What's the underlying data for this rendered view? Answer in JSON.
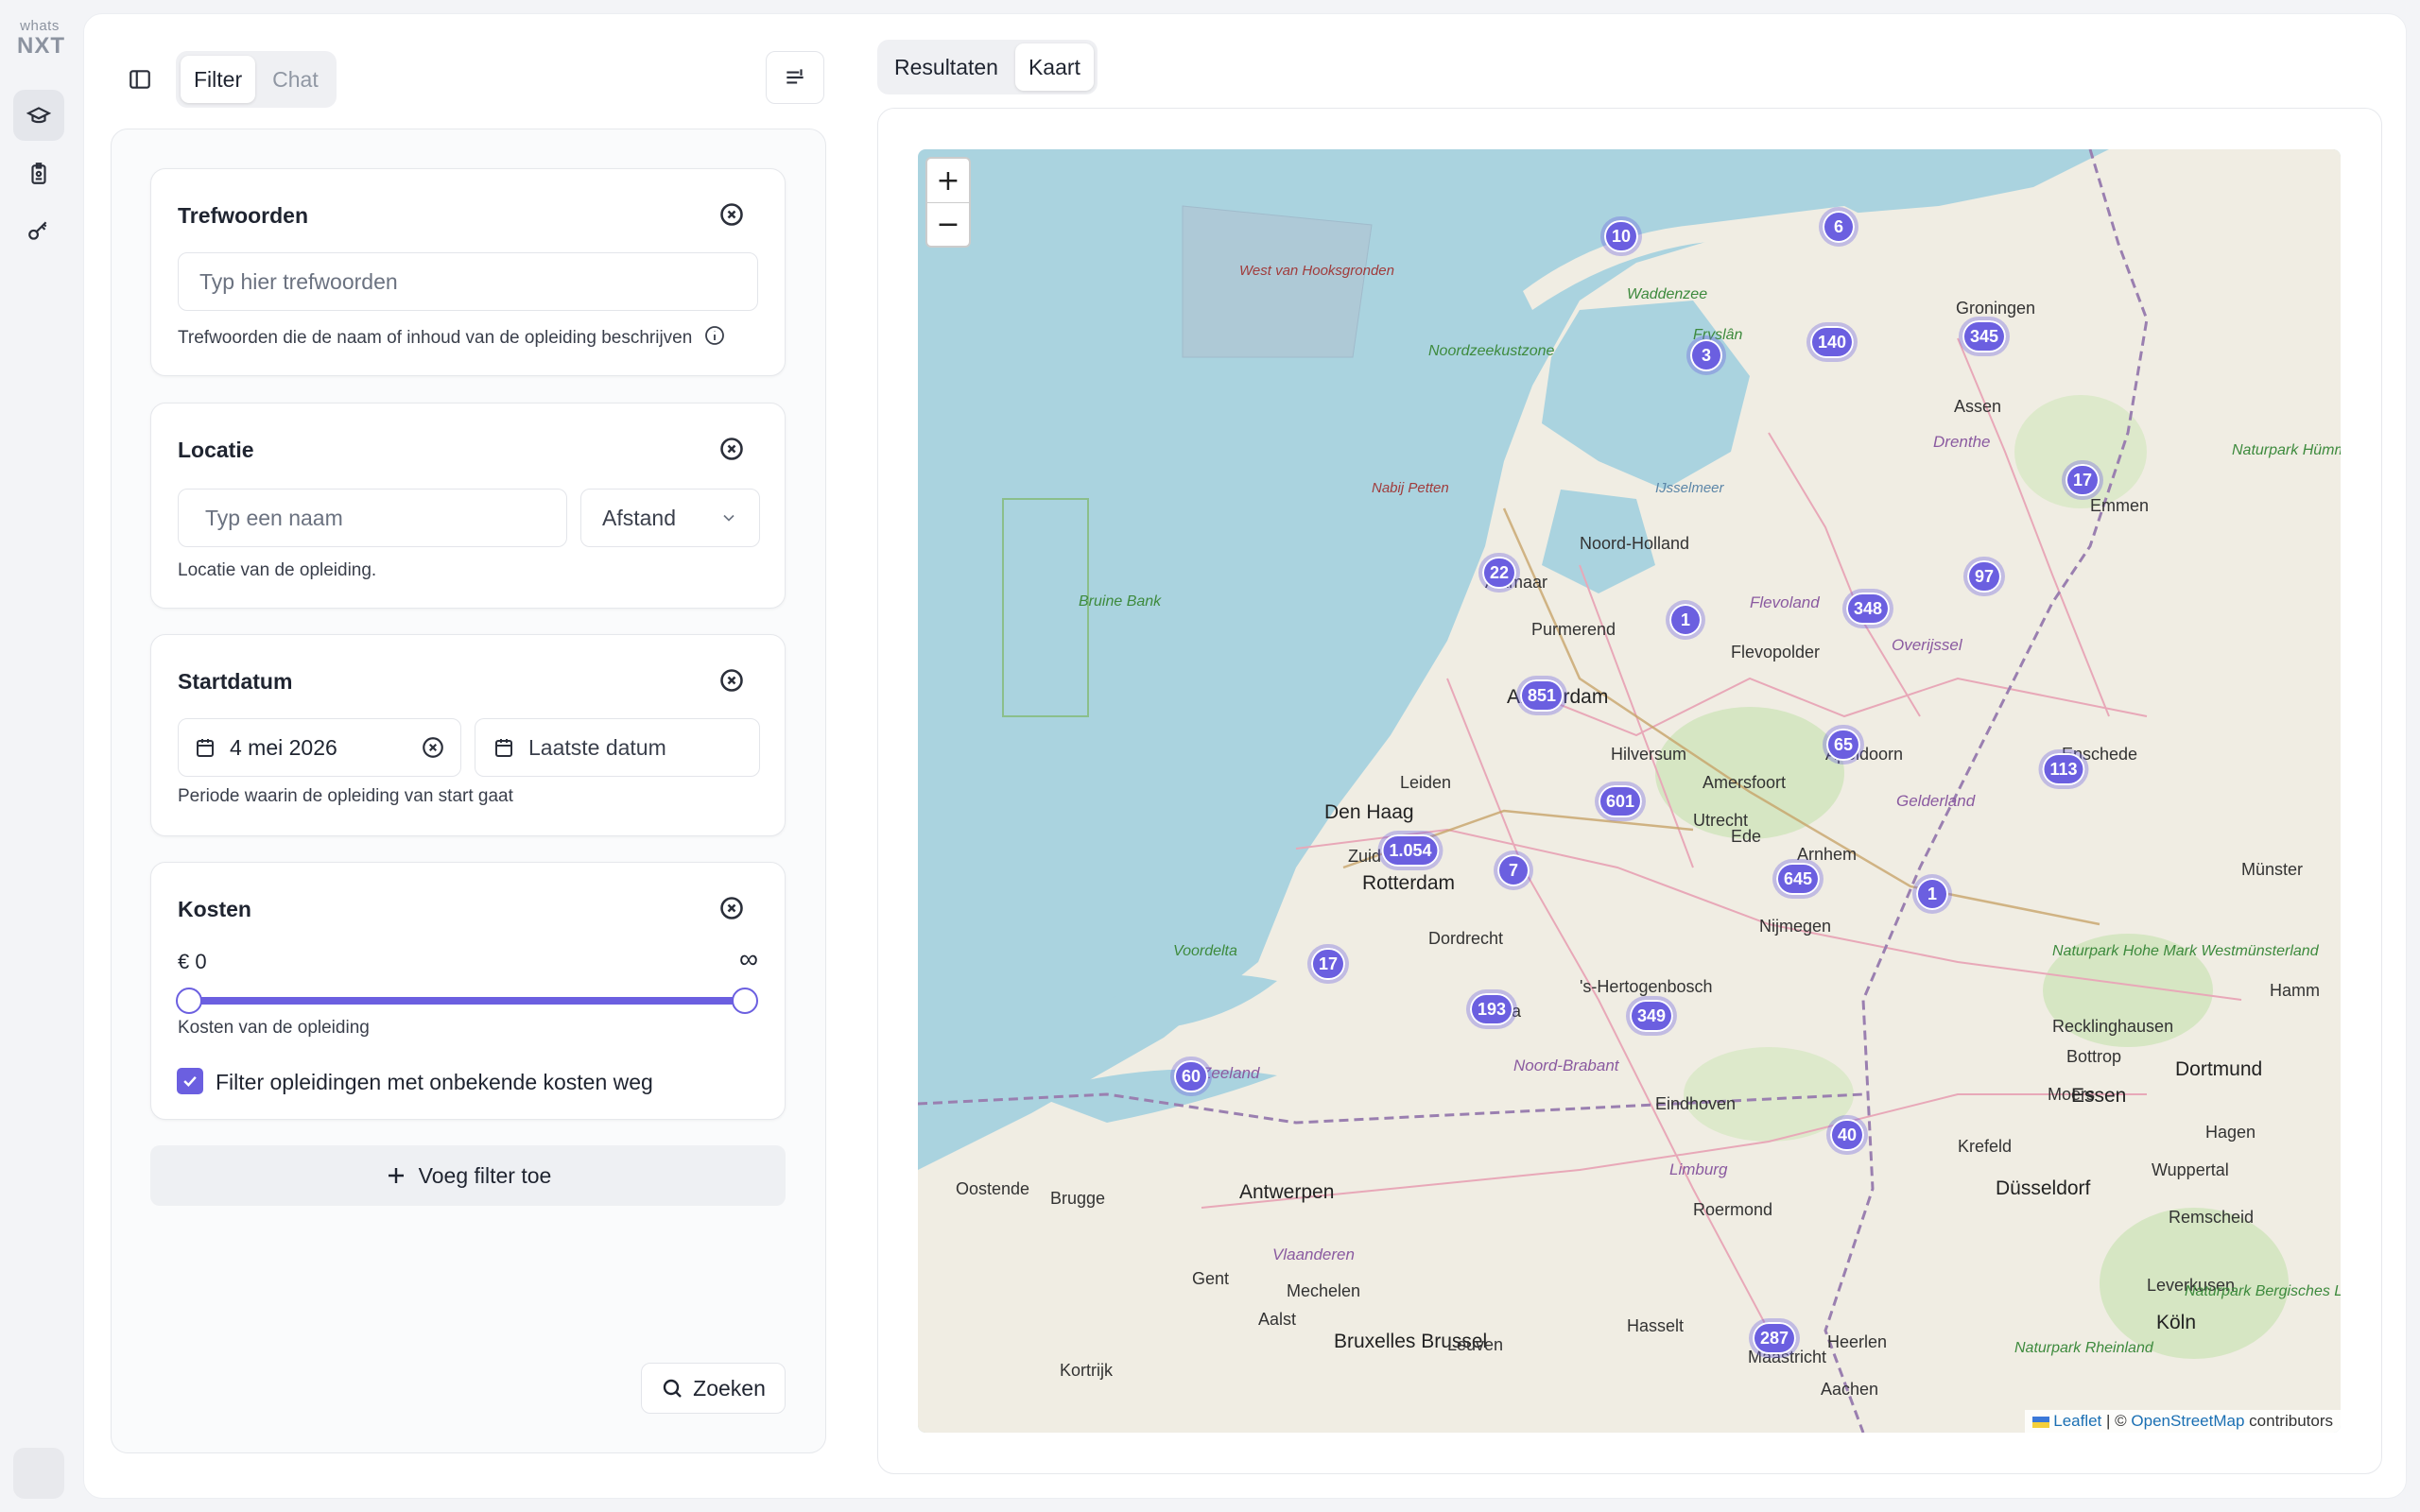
{
  "app": {
    "logo_top": "whats",
    "logo_bottom": "NXT"
  },
  "left_tabs": {
    "filter": "Filter",
    "chat": "Chat"
  },
  "right_tabs": {
    "results": "Resultaten",
    "map": "Kaart"
  },
  "cards": {
    "keywords": {
      "title": "Trefwoorden",
      "placeholder": "Typ hier trefwoorden",
      "helper": "Trefwoorden die de naam of inhoud van de opleiding beschrijven"
    },
    "location": {
      "title": "Locatie",
      "placeholder": "Typ een naam",
      "distance": "Afstand",
      "helper": "Locatie van de opleiding."
    },
    "startdate": {
      "title": "Startdatum",
      "from": "4 mei 2026",
      "to_placeholder": "Laatste datum",
      "helper": "Periode waarin de opleiding van start gaat"
    },
    "costs": {
      "title": "Kosten",
      "min": "€ 0",
      "max": "∞",
      "min_fraction": 0,
      "max_fraction": 1,
      "helper": "Kosten van de opleiding",
      "checkbox_label": "Filter opleidingen met onbekende kosten weg",
      "checkbox_checked": true
    }
  },
  "actions": {
    "add_filter": "Voeg filter toe",
    "search": "Zoeken"
  },
  "map": {
    "zoom_in": "+",
    "zoom_out": "−",
    "attribution_leaflet": "Leaflet",
    "attribution_sep": "| ©",
    "attribution_osm": "OpenStreetMap",
    "attribution_tail": "contributors",
    "clusters": [
      "10",
      "6",
      "3",
      "140",
      "345",
      "17",
      "22",
      "97",
      "1",
      "348",
      "851",
      "65",
      "113",
      "601",
      "1.054",
      "7",
      "645",
      "1",
      "17",
      "193",
      "349",
      "60",
      "40",
      "287"
    ],
    "places": [
      "West van Hooksgronden",
      "Waddenzee",
      "Noordzeekustzone",
      "Fryslân",
      "Groningen",
      "Assen",
      "Drenthe",
      "Nabij Petten",
      "Noord-Holland",
      "IJsselmeer",
      "Bruine Bank",
      "Alkmaar",
      "Purmerend",
      "Flevoland",
      "Flevopolder",
      "Overijssel",
      "Amsterdam",
      "Hilversum",
      "Amersfoort",
      "Apeldoorn",
      "Enschede",
      "Gelderland",
      "Leiden",
      "Den Haag",
      "Zuid",
      "Utrecht",
      "Ede",
      "Arnhem",
      "Rotterdam",
      "Dordrecht",
      "Nijmegen",
      "Münster",
      "Voordelta",
      "'s-Hertogenbosch",
      "Breda",
      "Noord-Brabant",
      "Eindhoven",
      "Zeeland",
      "Naturpark Hohe Mark Westmünsterland",
      "Recklinghausen",
      "Bottrop",
      "Dortmund",
      "Moers",
      "Essen",
      "Hagen",
      "Krefeld",
      "Wuppertal",
      "Oostende",
      "Brugge",
      "Antwerpen",
      "Limburg",
      "Roermond",
      "Düsseldorf",
      "Remscheid",
      "Vlaanderen",
      "Gent",
      "Mechelen",
      "Leverkusen",
      "Aalst",
      "Bruxelles Brussel",
      "Leuven",
      "Hasselt",
      "Köln",
      "Kortrijk",
      "Maastricht",
      "Heerlen",
      "Aachen",
      "Naturpark Bergisches Land",
      "Naturpark Rheinland",
      "Naturpark Hümmling",
      "Emmen",
      "Hamm"
    ]
  },
  "colors": {
    "accent": "#6b5fe0",
    "water": "#aad3df",
    "land": "#f2efe9"
  }
}
